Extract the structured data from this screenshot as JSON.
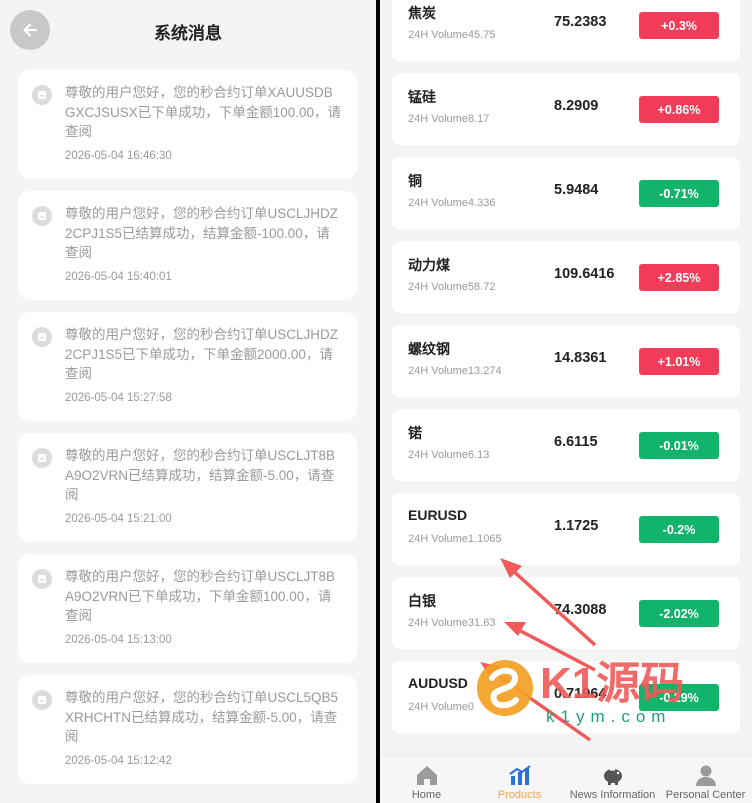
{
  "left": {
    "title": "系统消息",
    "messages": [
      {
        "text": "尊敬的用户您好，您的秒合约订单XAUUSDBGXCJSUSX已下单成功，下单金额100.00，请查阅",
        "time": "2026-05-04 16:46:30"
      },
      {
        "text": "尊敬的用户您好，您的秒合约订单USCLJHDZ2CPJ1S5已结算成功，结算金额-100.00，请查阅",
        "time": "2026-05-04 15:40:01"
      },
      {
        "text": "尊敬的用户您好，您的秒合约订单USCLJHDZ2CPJ1S5已下单成功，下单金额2000.00，请查阅",
        "time": "2026-05-04 15:27:58"
      },
      {
        "text": "尊敬的用户您好，您的秒合约订单USCLJT8BA9O2VRN已结算成功，结算金额-5.00，请查阅",
        "time": "2026-05-04 15:21:00"
      },
      {
        "text": "尊敬的用户您好，您的秒合约订单USCLJT8BA9O2VRN已下单成功，下单金额100.00，请查阅",
        "time": "2026-05-04 15:13:00"
      },
      {
        "text": "尊敬的用户您好，您的秒合约订单USCL5QB5XRHCHTN已结算成功，结算金额-5.00，请查阅",
        "time": "2026-05-04 15:12:42"
      }
    ]
  },
  "right": {
    "quotes": [
      {
        "name": "焦炭",
        "volume": "24H Volume45.75",
        "price": "75.2383",
        "change": "+0.3%",
        "dir": "up"
      },
      {
        "name": "锰硅",
        "volume": "24H Volume8.17",
        "price": "8.2909",
        "change": "+0.86%",
        "dir": "up"
      },
      {
        "name": "铜",
        "volume": "24H Volume4.336",
        "price": "5.9484",
        "change": "-0.71%",
        "dir": "down"
      },
      {
        "name": "动力煤",
        "volume": "24H Volume58.72",
        "price": "109.6416",
        "change": "+2.85%",
        "dir": "up"
      },
      {
        "name": "螺纹钢",
        "volume": "24H Volume13.274",
        "price": "14.8361",
        "change": "+1.01%",
        "dir": "up"
      },
      {
        "name": "锘",
        "volume": "24H Volume6.13",
        "price": "6.6115",
        "change": "-0.01%",
        "dir": "down"
      },
      {
        "name": "EURUSD",
        "volume": "24H Volume1.1065",
        "price": "1.1725",
        "change": "-0.2%",
        "dir": "down"
      },
      {
        "name": "白银",
        "volume": "24H Volume31.63",
        "price": "74.3088",
        "change": "-2.02%",
        "dir": "down"
      },
      {
        "name": "AUDUSD",
        "volume": "24H Volume0",
        "price": "0.71964",
        "change": "-0.29%",
        "dir": "down"
      }
    ],
    "tabs": [
      {
        "label": "Home",
        "icon": "home-icon",
        "active": false
      },
      {
        "label": "Products",
        "icon": "bar-chart-icon",
        "active": true
      },
      {
        "label": "News Information",
        "icon": "piggy-bank-icon",
        "active": false
      },
      {
        "label": "Personal Center",
        "icon": "user-icon",
        "active": false
      }
    ]
  },
  "watermark": {
    "brand": "K1源码",
    "domain": "k1ym.com"
  },
  "colors": {
    "up": "#f23c5a",
    "down": "#12b36b",
    "active_tab": "#f0a24b"
  }
}
